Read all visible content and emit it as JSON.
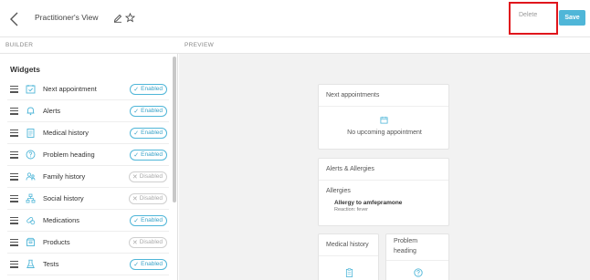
{
  "header": {
    "title": "Practitioner's View",
    "delete_label": "Delete",
    "save_label": "Save"
  },
  "sections": {
    "builder": "BUILDER",
    "preview": "PREVIEW"
  },
  "builder": {
    "heading": "Widgets",
    "widgets": [
      {
        "label": "Next appointment",
        "icon": "calendar-check-icon",
        "status": "Enabled",
        "enabled": true
      },
      {
        "label": "Alerts",
        "icon": "bell-icon",
        "status": "Enabled",
        "enabled": true
      },
      {
        "label": "Medical history",
        "icon": "clipboard-icon",
        "status": "Enabled",
        "enabled": true
      },
      {
        "label": "Problem heading",
        "icon": "question-icon",
        "status": "Enabled",
        "enabled": true
      },
      {
        "label": "Family history",
        "icon": "family-icon",
        "status": "Disabled",
        "enabled": false
      },
      {
        "label": "Social history",
        "icon": "network-icon",
        "status": "Disabled",
        "enabled": false
      },
      {
        "label": "Medications",
        "icon": "pills-icon",
        "status": "Enabled",
        "enabled": true
      },
      {
        "label": "Products",
        "icon": "box-icon",
        "status": "Disabled",
        "enabled": false
      },
      {
        "label": "Tests",
        "icon": "flask-icon",
        "status": "Enabled",
        "enabled": true
      }
    ]
  },
  "preview": {
    "next_appointments": {
      "title": "Next appointments",
      "empty": "No upcoming appointment"
    },
    "alerts": {
      "title": "Alerts & Allergies",
      "sub_heading": "Allergies",
      "allergy_name": "Allergy to amfepramone",
      "allergy_reaction": "Reaction: fever"
    },
    "medical_history": {
      "title": "Medical history"
    },
    "problem_heading": {
      "title": "Problem heading"
    }
  },
  "colors": {
    "accent": "#4fb6d8",
    "highlight": "#e0161c"
  }
}
